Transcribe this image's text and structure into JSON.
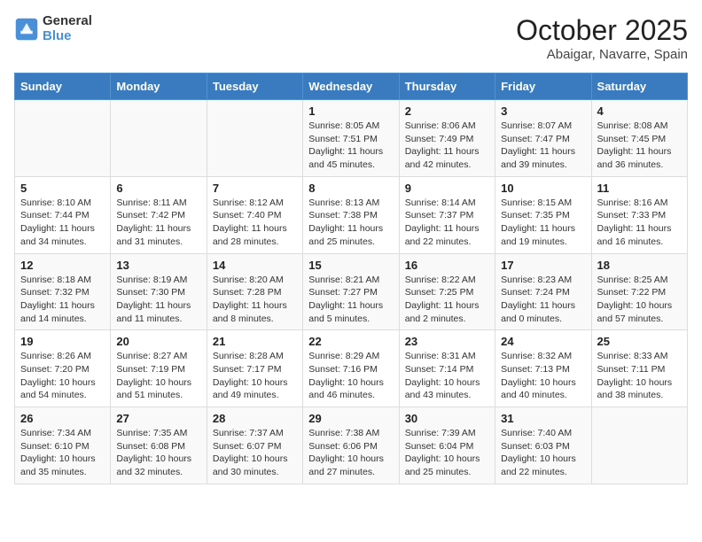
{
  "header": {
    "logo_line1": "General",
    "logo_line2": "Blue",
    "title": "October 2025",
    "subtitle": "Abaigar, Navarre, Spain"
  },
  "days_of_week": [
    "Sunday",
    "Monday",
    "Tuesday",
    "Wednesday",
    "Thursday",
    "Friday",
    "Saturday"
  ],
  "weeks": [
    [
      {
        "day": "",
        "info": ""
      },
      {
        "day": "",
        "info": ""
      },
      {
        "day": "",
        "info": ""
      },
      {
        "day": "1",
        "info": "Sunrise: 8:05 AM\nSunset: 7:51 PM\nDaylight: 11 hours and 45 minutes."
      },
      {
        "day": "2",
        "info": "Sunrise: 8:06 AM\nSunset: 7:49 PM\nDaylight: 11 hours and 42 minutes."
      },
      {
        "day": "3",
        "info": "Sunrise: 8:07 AM\nSunset: 7:47 PM\nDaylight: 11 hours and 39 minutes."
      },
      {
        "day": "4",
        "info": "Sunrise: 8:08 AM\nSunset: 7:45 PM\nDaylight: 11 hours and 36 minutes."
      }
    ],
    [
      {
        "day": "5",
        "info": "Sunrise: 8:10 AM\nSunset: 7:44 PM\nDaylight: 11 hours and 34 minutes."
      },
      {
        "day": "6",
        "info": "Sunrise: 8:11 AM\nSunset: 7:42 PM\nDaylight: 11 hours and 31 minutes."
      },
      {
        "day": "7",
        "info": "Sunrise: 8:12 AM\nSunset: 7:40 PM\nDaylight: 11 hours and 28 minutes."
      },
      {
        "day": "8",
        "info": "Sunrise: 8:13 AM\nSunset: 7:38 PM\nDaylight: 11 hours and 25 minutes."
      },
      {
        "day": "9",
        "info": "Sunrise: 8:14 AM\nSunset: 7:37 PM\nDaylight: 11 hours and 22 minutes."
      },
      {
        "day": "10",
        "info": "Sunrise: 8:15 AM\nSunset: 7:35 PM\nDaylight: 11 hours and 19 minutes."
      },
      {
        "day": "11",
        "info": "Sunrise: 8:16 AM\nSunset: 7:33 PM\nDaylight: 11 hours and 16 minutes."
      }
    ],
    [
      {
        "day": "12",
        "info": "Sunrise: 8:18 AM\nSunset: 7:32 PM\nDaylight: 11 hours and 14 minutes."
      },
      {
        "day": "13",
        "info": "Sunrise: 8:19 AM\nSunset: 7:30 PM\nDaylight: 11 hours and 11 minutes."
      },
      {
        "day": "14",
        "info": "Sunrise: 8:20 AM\nSunset: 7:28 PM\nDaylight: 11 hours and 8 minutes."
      },
      {
        "day": "15",
        "info": "Sunrise: 8:21 AM\nSunset: 7:27 PM\nDaylight: 11 hours and 5 minutes."
      },
      {
        "day": "16",
        "info": "Sunrise: 8:22 AM\nSunset: 7:25 PM\nDaylight: 11 hours and 2 minutes."
      },
      {
        "day": "17",
        "info": "Sunrise: 8:23 AM\nSunset: 7:24 PM\nDaylight: 11 hours and 0 minutes."
      },
      {
        "day": "18",
        "info": "Sunrise: 8:25 AM\nSunset: 7:22 PM\nDaylight: 10 hours and 57 minutes."
      }
    ],
    [
      {
        "day": "19",
        "info": "Sunrise: 8:26 AM\nSunset: 7:20 PM\nDaylight: 10 hours and 54 minutes."
      },
      {
        "day": "20",
        "info": "Sunrise: 8:27 AM\nSunset: 7:19 PM\nDaylight: 10 hours and 51 minutes."
      },
      {
        "day": "21",
        "info": "Sunrise: 8:28 AM\nSunset: 7:17 PM\nDaylight: 10 hours and 49 minutes."
      },
      {
        "day": "22",
        "info": "Sunrise: 8:29 AM\nSunset: 7:16 PM\nDaylight: 10 hours and 46 minutes."
      },
      {
        "day": "23",
        "info": "Sunrise: 8:31 AM\nSunset: 7:14 PM\nDaylight: 10 hours and 43 minutes."
      },
      {
        "day": "24",
        "info": "Sunrise: 8:32 AM\nSunset: 7:13 PM\nDaylight: 10 hours and 40 minutes."
      },
      {
        "day": "25",
        "info": "Sunrise: 8:33 AM\nSunset: 7:11 PM\nDaylight: 10 hours and 38 minutes."
      }
    ],
    [
      {
        "day": "26",
        "info": "Sunrise: 7:34 AM\nSunset: 6:10 PM\nDaylight: 10 hours and 35 minutes."
      },
      {
        "day": "27",
        "info": "Sunrise: 7:35 AM\nSunset: 6:08 PM\nDaylight: 10 hours and 32 minutes."
      },
      {
        "day": "28",
        "info": "Sunrise: 7:37 AM\nSunset: 6:07 PM\nDaylight: 10 hours and 30 minutes."
      },
      {
        "day": "29",
        "info": "Sunrise: 7:38 AM\nSunset: 6:06 PM\nDaylight: 10 hours and 27 minutes."
      },
      {
        "day": "30",
        "info": "Sunrise: 7:39 AM\nSunset: 6:04 PM\nDaylight: 10 hours and 25 minutes."
      },
      {
        "day": "31",
        "info": "Sunrise: 7:40 AM\nSunset: 6:03 PM\nDaylight: 10 hours and 22 minutes."
      },
      {
        "day": "",
        "info": ""
      }
    ]
  ],
  "colors": {
    "header_bg": "#3a7abf",
    "logo_blue": "#4a90d9"
  }
}
